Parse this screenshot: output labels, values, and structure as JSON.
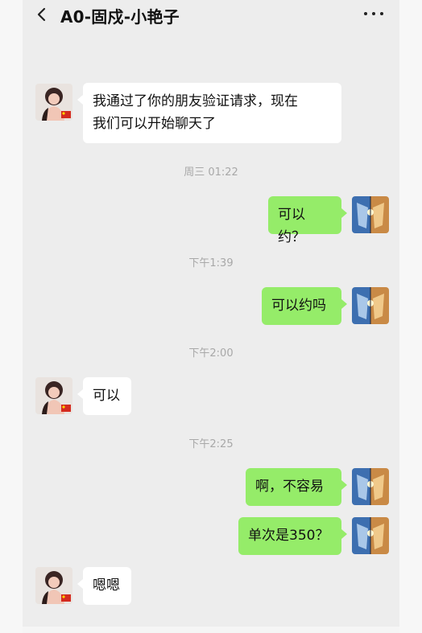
{
  "header": {
    "title": "A0-固戍-小艳子"
  },
  "icons": {
    "back": "back-arrow-icon",
    "more": "more-dots-icon"
  },
  "messages": [
    {
      "side": "in",
      "text": "我通过了你的朋友验证请求，现在我们可以开始聊天了"
    },
    {
      "side": "out",
      "text": "可以约？"
    },
    {
      "side": "out",
      "text": "可以约吗"
    },
    {
      "side": "in",
      "text": "可以"
    },
    {
      "side": "out",
      "text": "啊，不容易"
    },
    {
      "side": "out",
      "text": "单次是350？"
    },
    {
      "side": "in",
      "text": "嗯嗯"
    }
  ],
  "message_lines": {
    "first_line1": "我通过了你的朋友验证请求，现在",
    "first_line2": "我们可以开始聊天了"
  },
  "timestamps": [
    "周三 01:22",
    "下午1:39",
    "下午2:00",
    "下午2:25"
  ],
  "colors": {
    "background": "#ededed",
    "bubble_in": "#ffffff",
    "bubble_out": "#95ec69",
    "timestamp": "#a8a8a8"
  }
}
